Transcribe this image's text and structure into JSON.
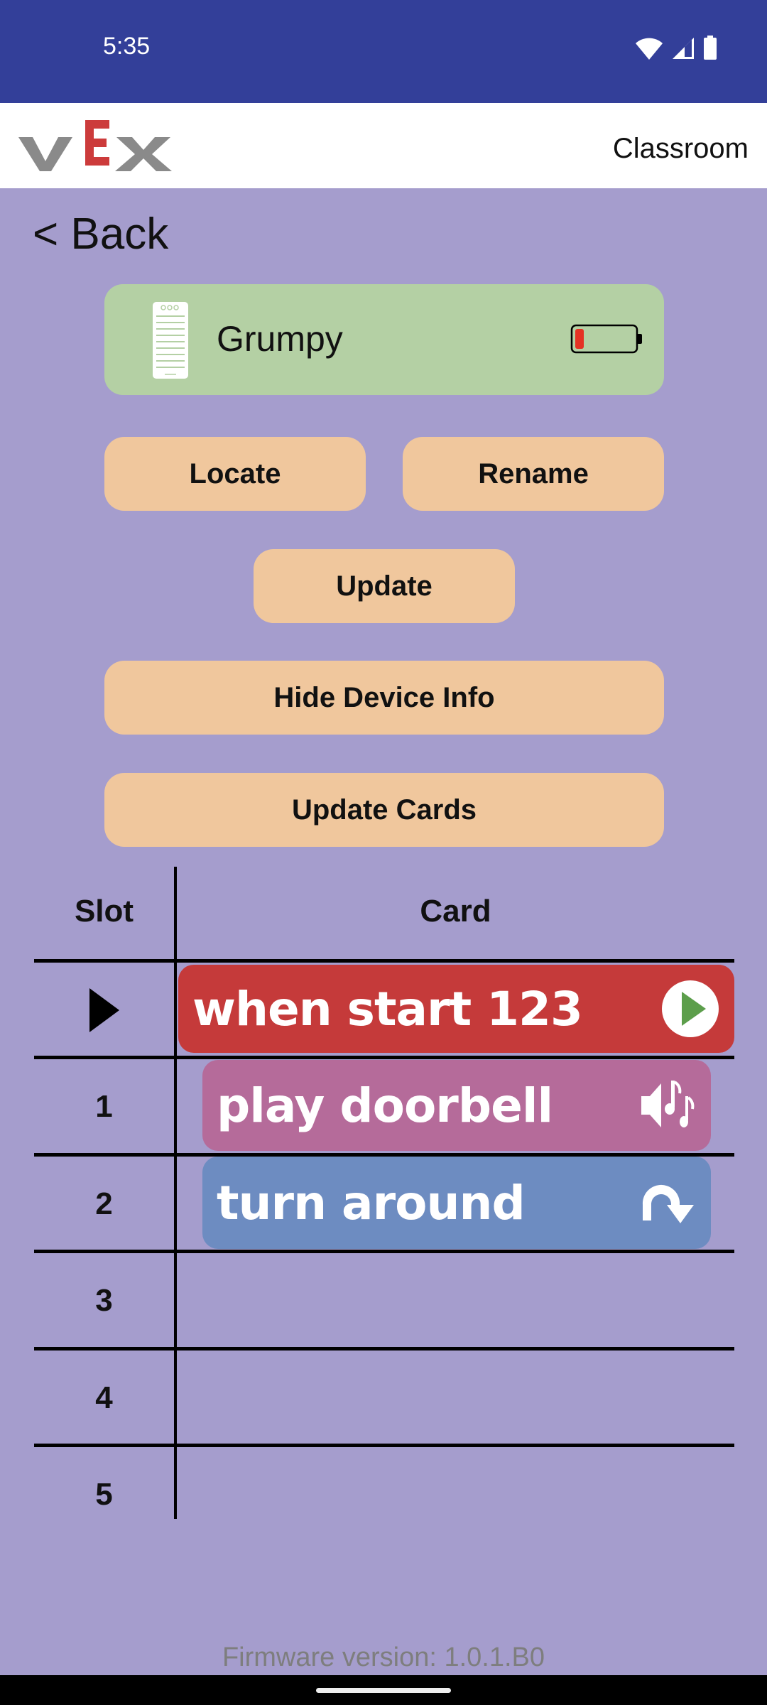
{
  "status_bar": {
    "time": "5:35",
    "icons": [
      "wifi-icon",
      "cellular-signal-icon",
      "battery-icon"
    ]
  },
  "header": {
    "logo": "VEX",
    "title": "Classroom"
  },
  "nav": {
    "back_label": "< Back"
  },
  "device": {
    "name": "Grumpy",
    "icon": "brain-device-icon",
    "battery_level": 0.15,
    "battery_color": "#e53224"
  },
  "buttons": {
    "locate": "Locate",
    "rename": "Rename",
    "update": "Update",
    "hide_device_info": "Hide Device Info",
    "update_cards": "Update Cards"
  },
  "table": {
    "headers": {
      "slot": "Slot",
      "card": "Card"
    },
    "rows": [
      {
        "slot": "",
        "slot_icon": "play-triangle-icon",
        "card": "when start 123",
        "card_color": "#c53a3a",
        "card_icon": "start-play-icon"
      },
      {
        "slot": "1",
        "card": "play doorbell",
        "card_color": "#b56b9a",
        "card_icon": "sound-note-icon"
      },
      {
        "slot": "2",
        "card": "turn around",
        "card_color": "#6d8cc1",
        "card_icon": "turn-around-icon"
      },
      {
        "slot": "3",
        "card": ""
      },
      {
        "slot": "4",
        "card": ""
      },
      {
        "slot": "5",
        "card": ""
      }
    ]
  },
  "footer": {
    "firmware": "Firmware version: 1.0.1.B0"
  },
  "colors": {
    "status_bar": "#333f99",
    "background": "#a59dcd",
    "device_card": "#b4d0a4",
    "button": "#f0c79d",
    "logo_gray": "#8a8a8a",
    "logo_red": "#cc3b3b"
  }
}
